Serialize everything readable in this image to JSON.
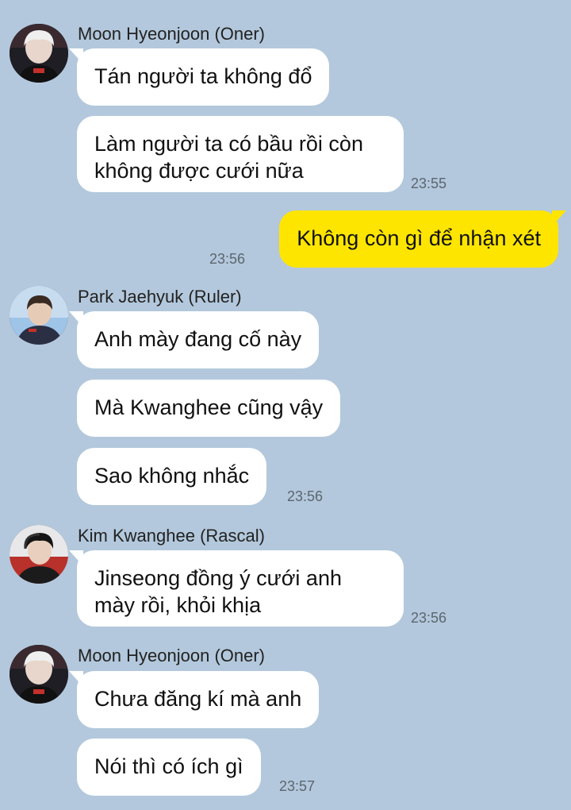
{
  "colors": {
    "background": "#b3c8dc",
    "incoming_bubble": "#ffffff",
    "outgoing_bubble": "#fee500"
  },
  "messages": [
    {
      "sender": "Moon Hyeonjoon (Oner)",
      "avatar": "oner-avatar",
      "bubbles": [
        "Tán người ta không đổ",
        "Làm người ta có bầu rồi còn\nkhông được cưới nữa"
      ],
      "time": "23:55"
    },
    {
      "sender": "",
      "outgoing": true,
      "bubbles": [
        "Không còn gì để nhận xét"
      ],
      "time": "23:56"
    },
    {
      "sender": "Park Jaehyuk (Ruler)",
      "avatar": "ruler-avatar",
      "bubbles": [
        "Anh mày đang cố này",
        "Mà Kwanghee cũng vậy",
        "Sao không nhắc"
      ],
      "time": "23:56"
    },
    {
      "sender": "Kim Kwanghee (Rascal)",
      "avatar": "rascal-avatar",
      "bubbles": [
        "Jinseong đồng ý cưới anh\nmày rồi, khỏi khịa"
      ],
      "time": "23:56"
    },
    {
      "sender": "Moon Hyeonjoon (Oner)",
      "avatar": "oner-avatar",
      "bubbles": [
        "Chưa đăng kí mà anh",
        "Nói thì có ích gì"
      ],
      "time": "23:57"
    }
  ]
}
